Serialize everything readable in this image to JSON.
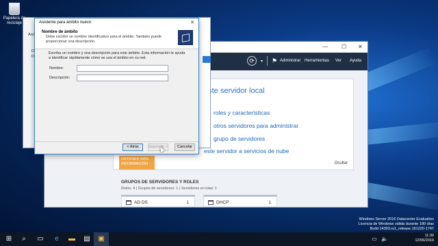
{
  "desktop": {
    "recycle_bin_label": "Papelera de reciclaje"
  },
  "server_manager": {
    "menu": [
      "Administrar",
      "Herramientas",
      "Ver",
      "Ayuda"
    ],
    "quick_start": {
      "title": "este servidor local",
      "items": [
        "roles y características",
        "otros servidores para administrar",
        "grupo de servidores",
        "este servidor a servicios de nube"
      ],
      "more_info": "OBTENER MÁS INFORMACIÓN",
      "hide": "Ocultar"
    },
    "groups": {
      "title": "GRUPOS DE SERVIDORES Y ROLES",
      "subtitle": "Roles: 4  |  Grupos de servidores: 1  |  Servidores en total: 1",
      "tiles": [
        {
          "name": "AD DS",
          "count": "1"
        },
        {
          "name": "DHCP",
          "count": "1"
        }
      ]
    }
  },
  "back_window": {
    "items": [
      "Arch",
      "D",
      "D"
    ]
  },
  "wizard": {
    "title": "Asistente para ámbito nuevo",
    "heading": "Nombre de ámbito",
    "subheading": "Debe escribir un nombre identificativo para el ámbito. También puede proporcionar una descripción.",
    "description": "Escriba un nombre y una descripción para este ámbito. Esta información le ayuda a identificar rápidamente cómo se usa el ámbito en su red.",
    "name_label": "Nombre:",
    "name_value": "",
    "desc_label": "Descripción:",
    "desc_value": "",
    "back_button": "< Atrás",
    "next_button": "Siguiente >",
    "cancel_button": "Cancelar"
  },
  "watermark": {
    "line1": "Windows Server 2016 Datacenter Evaluation",
    "line2": "Licencia de Windows válida durante 180 días",
    "line3": "Build 14393.rs1_release.161220-1747"
  },
  "clock": {
    "time": "11:30",
    "date": "12/06/2019"
  }
}
